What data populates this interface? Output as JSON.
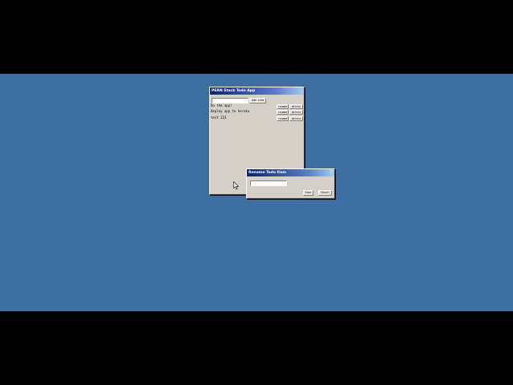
{
  "main_window": {
    "title": "PERN Stack Todo App",
    "new_item_value": "",
    "add_button": "Add item",
    "todos": [
      {
        "text": "Do the app!",
        "rename": "rename",
        "delete": "delete"
      },
      {
        "text": "Deploy app to heroku",
        "rename": "rename",
        "delete": "delete"
      },
      {
        "text": "test 123",
        "rename": "rename",
        "delete": "delete"
      }
    ]
  },
  "rename_dialog": {
    "title": "Rename Todo Item",
    "close": "×",
    "input_value": "",
    "save_button": "Save",
    "cancel_button": "Cancel"
  },
  "colors": {
    "desktop": "#3d6fa3",
    "window_face": "#d4d0c8",
    "title_active": "#0a246a"
  }
}
